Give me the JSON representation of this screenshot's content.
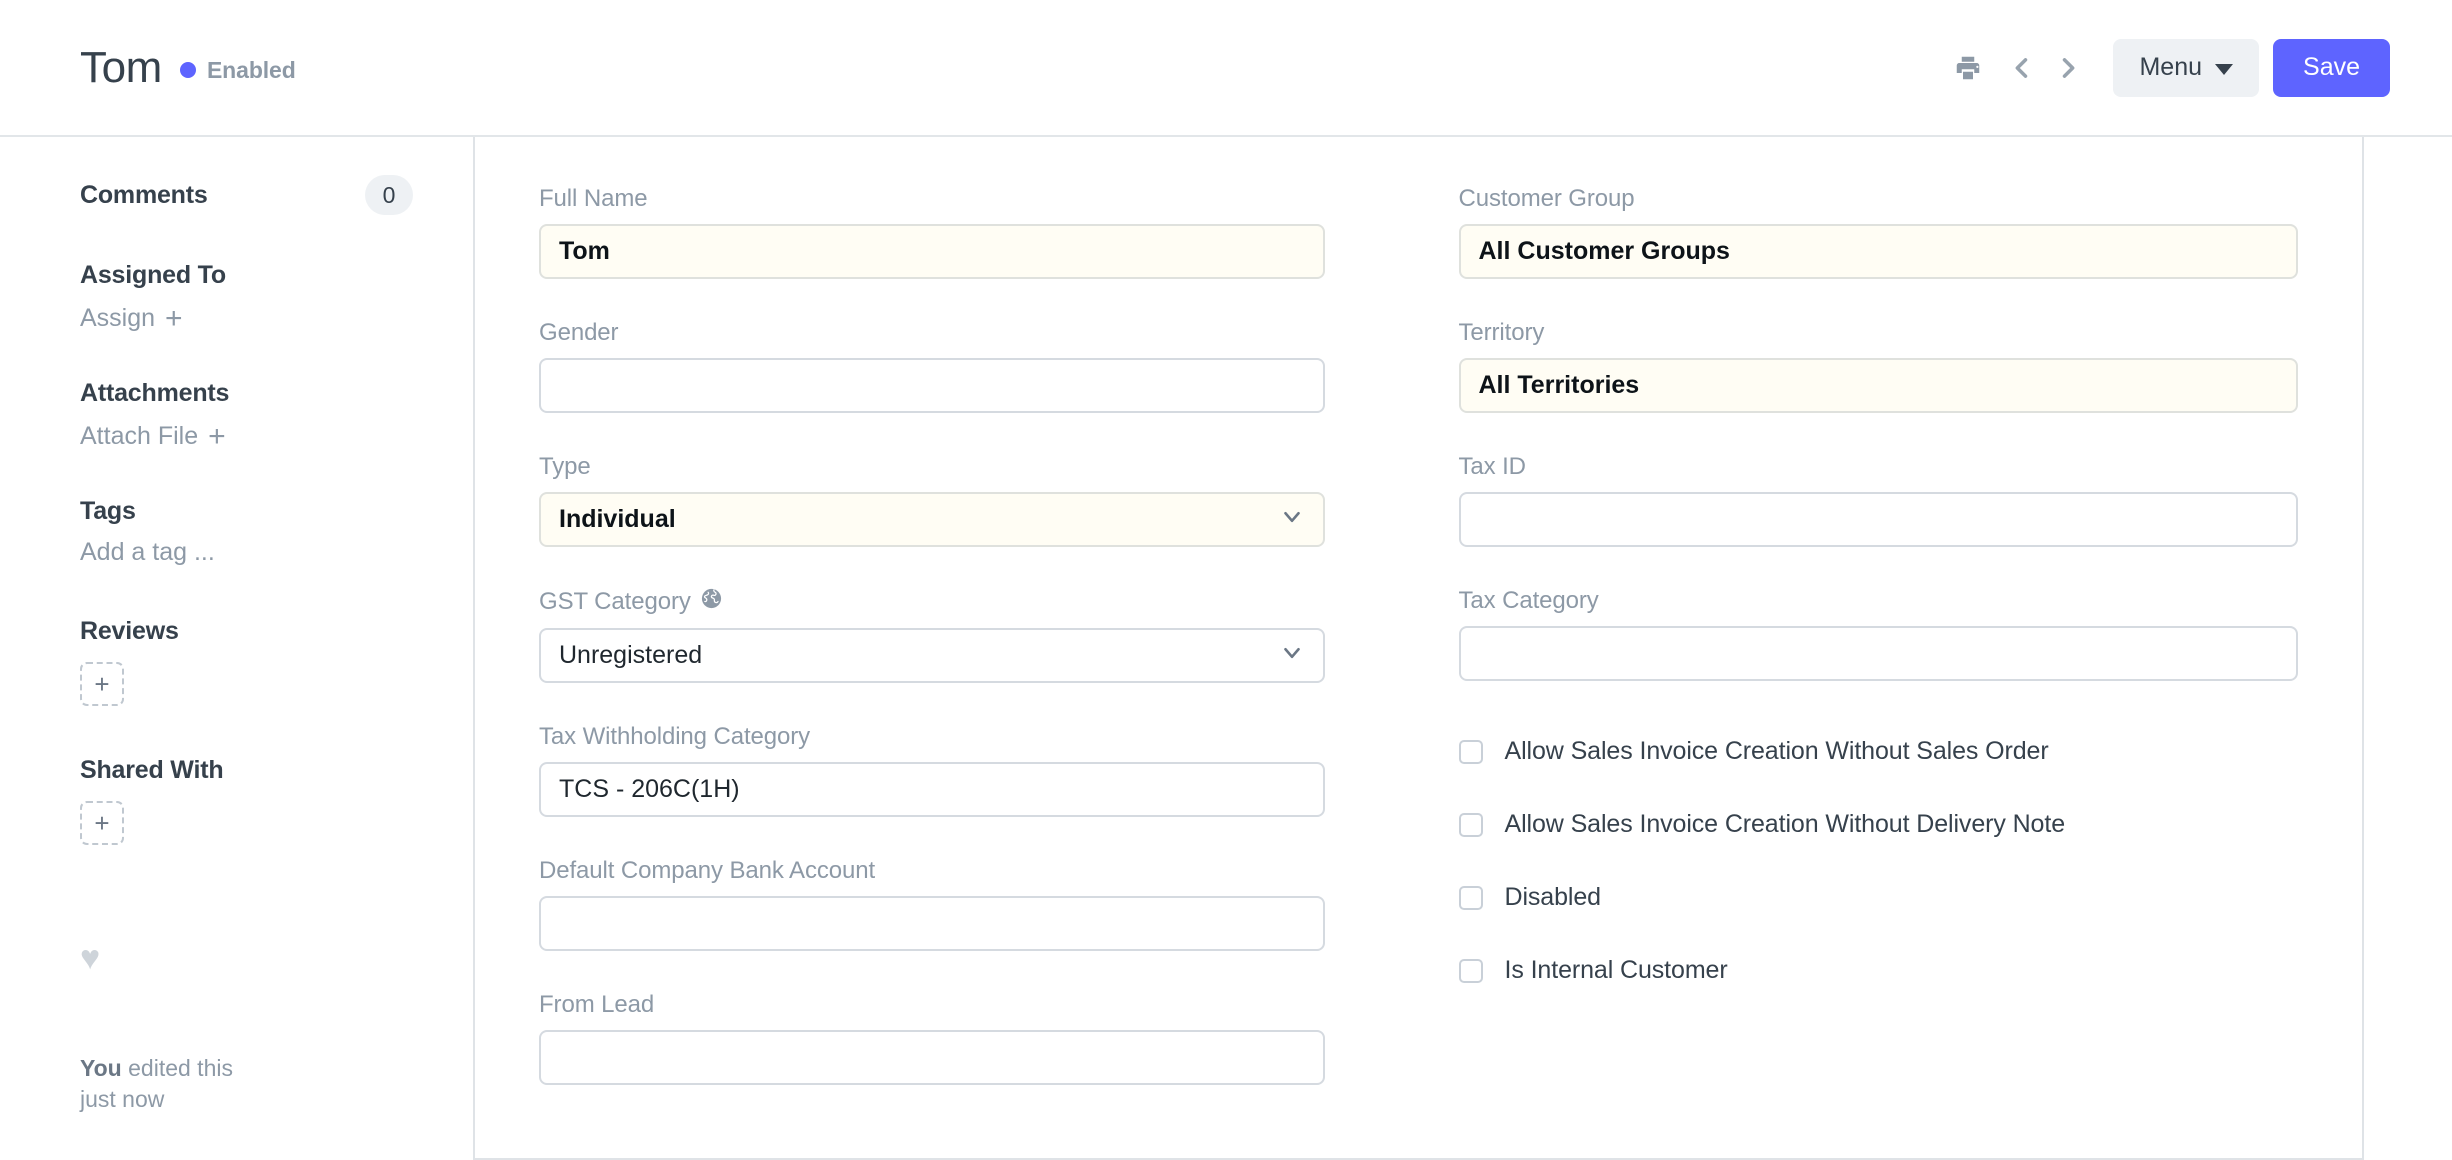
{
  "header": {
    "title": "Tom",
    "status": "Enabled",
    "status_color": "#5e64ff",
    "print_icon": "printer-icon",
    "prev_icon": "chevron-left-icon",
    "next_icon": "chevron-right-icon",
    "menu_label": "Menu",
    "save_label": "Save",
    "save_color": "#5e64ff"
  },
  "sidebar": {
    "comments_label": "Comments",
    "comments_count": "0",
    "assigned_to_label": "Assigned To",
    "assign_label": "Assign",
    "attachments_label": "Attachments",
    "attach_file_label": "Attach File",
    "tags_label": "Tags",
    "add_tag_label": "Add a tag ...",
    "reviews_label": "Reviews",
    "reviews_add": "+",
    "shared_with_label": "Shared With",
    "shared_with_add": "+",
    "like_icon": "heart-icon",
    "edited_by": "You",
    "edited_text": " edited this",
    "edited_time": "just now"
  },
  "form": {
    "left": [
      {
        "label": "Full Name",
        "value": "Tom",
        "mandatory": true,
        "type": "text"
      },
      {
        "label": "Gender",
        "value": "",
        "mandatory": false,
        "type": "text"
      },
      {
        "label": "Type",
        "value": "Individual",
        "mandatory": true,
        "type": "select"
      },
      {
        "label": "GST Category",
        "value": "Unregistered",
        "mandatory": false,
        "type": "select",
        "icon": "globe-icon"
      },
      {
        "label": "Tax Withholding Category",
        "value": "TCS - 206C(1H)",
        "mandatory": false,
        "type": "text"
      },
      {
        "label": "Default Company Bank Account",
        "value": "",
        "mandatory": false,
        "type": "text"
      },
      {
        "label": "From Lead",
        "value": "",
        "mandatory": false,
        "type": "text"
      }
    ],
    "right": [
      {
        "label": "Customer Group",
        "value": "All Customer Groups",
        "mandatory": true,
        "type": "text"
      },
      {
        "label": "Territory",
        "value": "All Territories",
        "mandatory": true,
        "type": "text"
      },
      {
        "label": "Tax ID",
        "value": "",
        "mandatory": false,
        "type": "text"
      },
      {
        "label": "Tax Category",
        "value": "",
        "mandatory": false,
        "type": "text"
      }
    ],
    "checkboxes": [
      {
        "label": "Allow Sales Invoice Creation Without Sales Order",
        "checked": false
      },
      {
        "label": "Allow Sales Invoice Creation Without Delivery Note",
        "checked": false
      },
      {
        "label": "Disabled",
        "checked": false
      },
      {
        "label": "Is Internal Customer",
        "checked": false
      }
    ]
  }
}
